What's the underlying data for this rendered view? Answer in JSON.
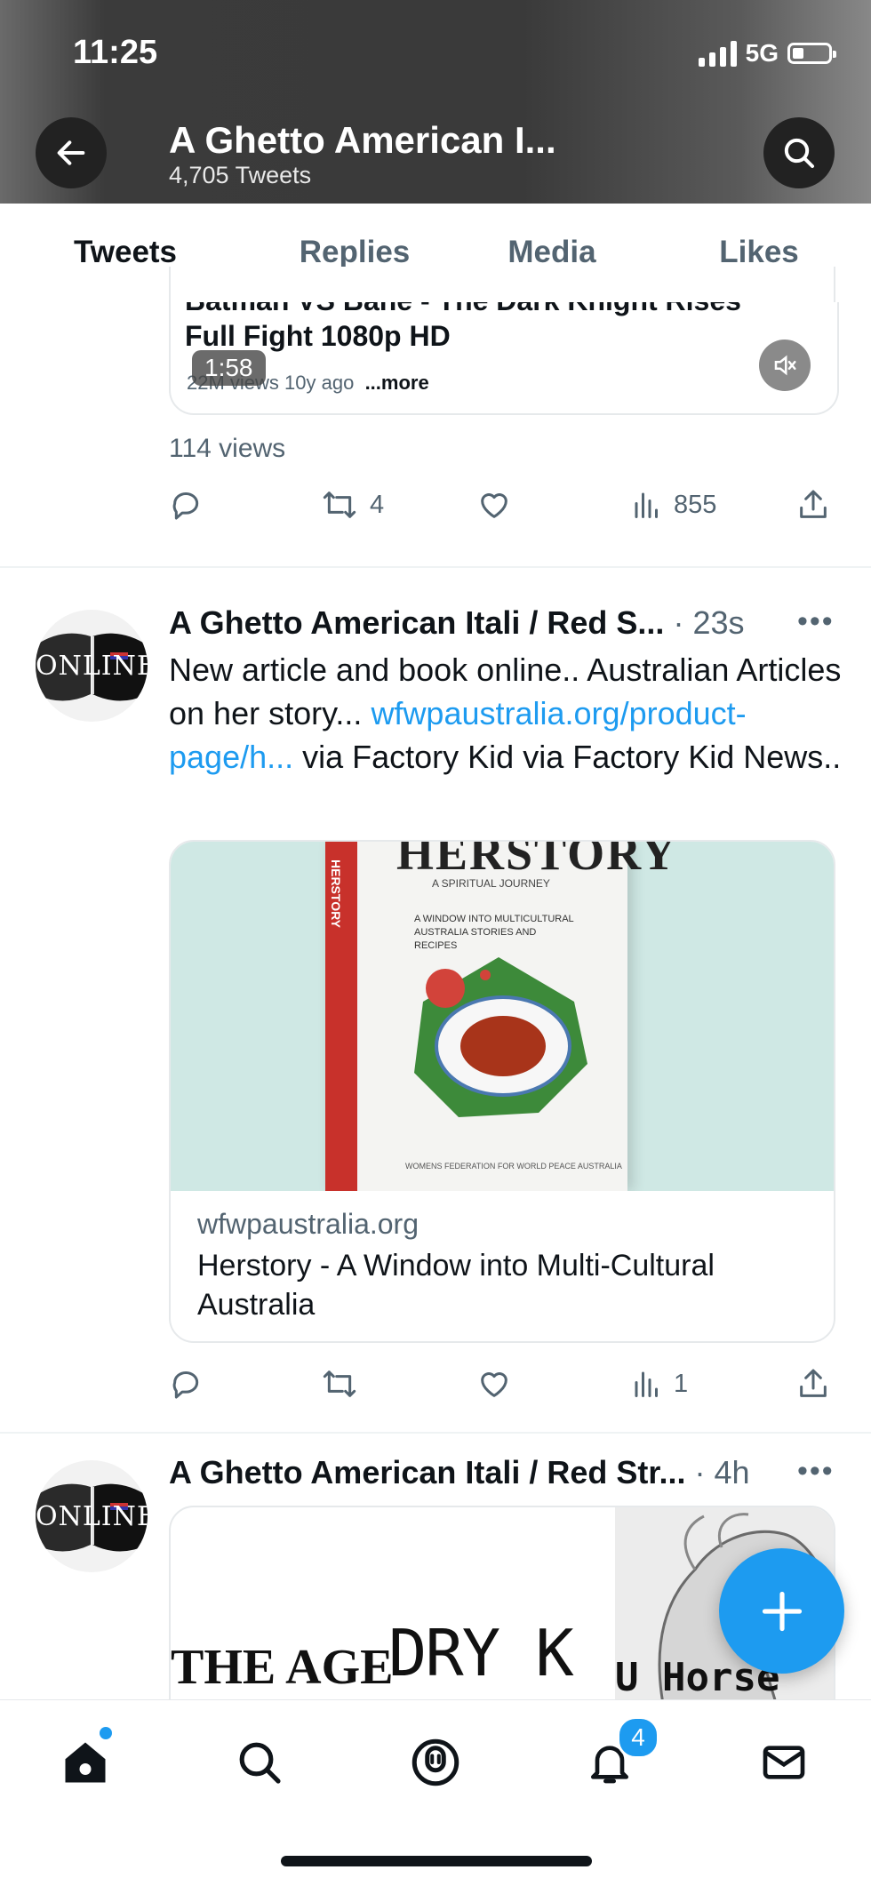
{
  "status_bar": {
    "time": "11:25",
    "network": "5G"
  },
  "header": {
    "title": "A Ghetto American I...",
    "subtitle": "4,705 Tweets"
  },
  "tabs": [
    {
      "label": "Tweets",
      "active": true
    },
    {
      "label": "Replies",
      "active": false
    },
    {
      "label": "Media",
      "active": false
    },
    {
      "label": "Likes",
      "active": false
    }
  ],
  "tweet1": {
    "video_card": {
      "title_line1": "Batman VS Bane - The Dark Knight Rises",
      "title_line2": "Full Fight 1080p HD",
      "duration": "1:58",
      "meta": "22M views  10y ago",
      "more": "...more"
    },
    "views": "114 views",
    "actions": {
      "retweets": "4",
      "views_count": "855"
    }
  },
  "tweet2": {
    "author": "A Ghetto American Itali / Red S...",
    "time": "· 23s",
    "avatar_text": "ONLINE",
    "text_before": "New article and book online.. Australian Articles on her story... ",
    "link": "wfwpaustralia.org/product-page/h...",
    "text_after": " via Factory Kid via Factory Kid News..",
    "card": {
      "domain": "wfwpaustralia.org",
      "title": "Herstory - A Window into Multi-Cultural Australia",
      "book_title": "HERSTORY",
      "book_subtitle": "A SPIRITUAL JOURNEY",
      "book_tagline": "A WINDOW INTO MULTICULTURAL AUSTRALIA STORIES AND RECIPES",
      "book_spine": "HERSTORY",
      "book_footer": "WOMENS FEDERATION FOR WORLD PEACE AUSTRALIA"
    },
    "actions": {
      "views_count": "1"
    }
  },
  "tweet3": {
    "author": "A Ghetto American Itali / Red Str...",
    "time": "· 4h",
    "avatar_text": "ONLINE",
    "image_text_left": "THE AGE",
    "image_text_mid": "DRY K",
    "image_text_right": "U Horse"
  },
  "bottom_nav": {
    "notifications_badge": "4"
  },
  "colors": {
    "accent": "#1d9bf0",
    "text": "#0f1419",
    "muted": "#536471"
  }
}
